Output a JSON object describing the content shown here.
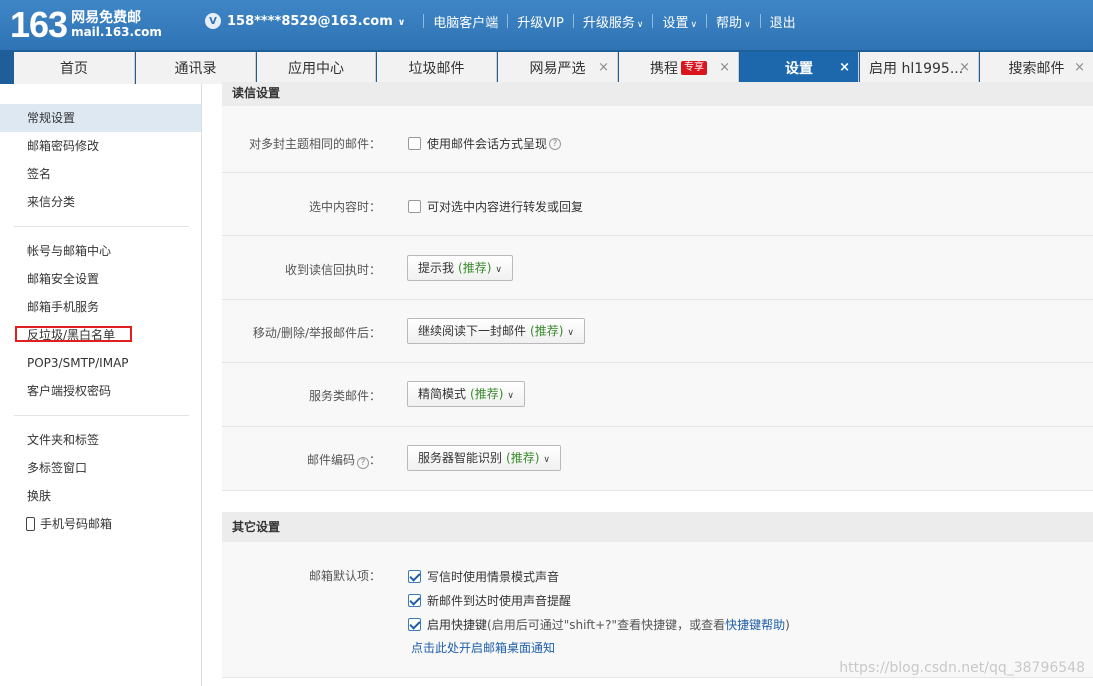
{
  "header": {
    "logo_number": "163",
    "logo_name": "网易免费邮",
    "logo_domain": "mail.163.com",
    "vip_badge": "V",
    "account": "158****8529@163.com",
    "nav": [
      "电脑客户端",
      "升级VIP",
      "升级服务",
      "设置",
      "帮助",
      "退出"
    ]
  },
  "tabs": [
    {
      "label": "首页"
    },
    {
      "label": "通讯录"
    },
    {
      "label": "应用中心"
    },
    {
      "label": "垃圾邮件"
    },
    {
      "label": "网易严选"
    },
    {
      "label": "携程",
      "tag": "专享"
    },
    {
      "label": "设置"
    },
    {
      "label": "启用 hl1995..."
    },
    {
      "label": "搜索邮件"
    }
  ],
  "tab_close": "×",
  "sidebar": {
    "items": [
      "常规设置",
      "邮箱密码修改",
      "签名",
      "来信分类",
      "帐号与邮箱中心",
      "邮箱安全设置",
      "邮箱手机服务",
      "反垃圾/黑白名单",
      "POP3/SMTP/IMAP",
      "客户端授权密码",
      "文件夹和标签",
      "多标签窗口",
      "换肤",
      "手机号码邮箱"
    ]
  },
  "read_settings": {
    "title": "读信设置",
    "conversation": {
      "label": "对多封主题相同的邮件：",
      "option": "使用邮件会话方式呈现",
      "checked": false
    },
    "selection": {
      "label": "选中内容时：",
      "option": "可对选中内容进行转发或回复",
      "checked": false
    },
    "receipt": {
      "label": "收到读信回执时：",
      "value": "提示我",
      "rec": "(推荐)"
    },
    "after_action": {
      "label": "移动/删除/举报邮件后：",
      "value": "继续阅读下一封邮件",
      "rec": "(推荐)"
    },
    "service_mail": {
      "label": "服务类邮件：",
      "value": "精简模式",
      "rec": "(推荐)"
    },
    "encoding": {
      "label": "邮件编码",
      "label_suffix": "：",
      "value": "服务器智能识别",
      "rec": "(推荐)"
    }
  },
  "other_settings": {
    "title": "其它设置",
    "defaults_label": "邮箱默认项：",
    "options": [
      {
        "text": "写信时使用情景模式声音",
        "checked": true
      },
      {
        "text": "新邮件到达时使用声音提醒",
        "checked": true
      }
    ],
    "shortcut": {
      "prefix": "启用快捷键",
      "note": "(启用后可通过\"shift+?\"查看快捷键，或查看 ",
      "link": "快捷键帮助",
      "suffix": " )",
      "checked": true
    },
    "desktop_link": "点击此处开启邮箱桌面通知"
  },
  "watermark": "https://blog.csdn.net/qq_38796548"
}
